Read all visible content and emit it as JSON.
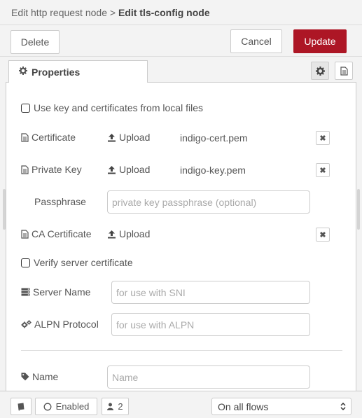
{
  "header": {
    "parent_crumb": "Edit http request node",
    "separator": ">",
    "current_crumb": "Edit tls-config node"
  },
  "toolbar": {
    "delete_label": "Delete",
    "cancel_label": "Cancel",
    "update_label": "Update"
  },
  "tabs": {
    "properties_label": "Properties"
  },
  "form": {
    "use_local_files_label": "Use key and certificates from local files",
    "certificate": {
      "label": "Certificate",
      "upload_label": "Upload",
      "filename": "indigo-cert.pem",
      "clear": "✖"
    },
    "private_key": {
      "label": "Private Key",
      "upload_label": "Upload",
      "filename": "indigo-key.pem",
      "clear": "✖"
    },
    "passphrase": {
      "label": "Passphrase",
      "placeholder": "private key passphrase (optional)"
    },
    "ca_certificate": {
      "label": "CA Certificate",
      "upload_label": "Upload",
      "clear": "✖"
    },
    "verify_server_label": "Verify server certificate",
    "server_name": {
      "label": "Server Name",
      "placeholder": "for use with SNI"
    },
    "alpn_protocol": {
      "label": "ALPN Protocol",
      "placeholder": "for use with ALPN"
    },
    "name": {
      "label": "Name",
      "placeholder": "Name"
    }
  },
  "footer": {
    "enabled_label": "Enabled",
    "users_count": "2",
    "scope_selected": "On all flows"
  },
  "colors": {
    "accent": "#ad1625",
    "border": "#cccccc",
    "background": "#f3f3f3"
  }
}
